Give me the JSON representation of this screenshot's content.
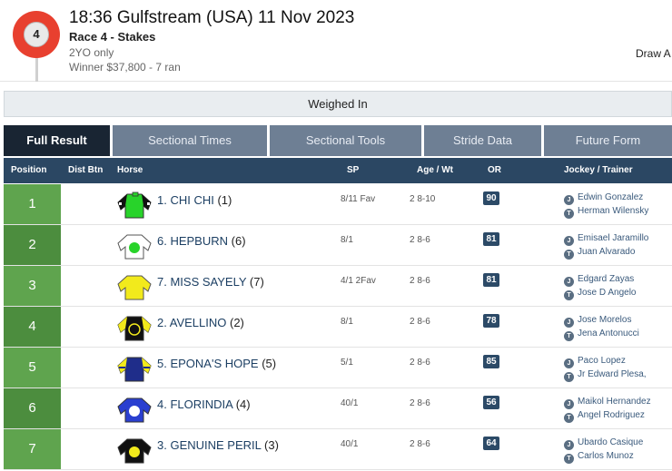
{
  "race": {
    "number": "4",
    "title": "18:36 Gulfstream (USA) 11 Nov 2023",
    "subtitle": "Race 4 - Stakes",
    "age_restriction": "2YO only",
    "winner_prize": "Winner $37,800 - 7 ran",
    "draw_label": "Draw A"
  },
  "status": {
    "weighed_in": "Weighed In"
  },
  "tabs": [
    {
      "label": "Full Result",
      "active": true
    },
    {
      "label": "Sectional Times",
      "active": false
    },
    {
      "label": "Sectional Tools",
      "active": false
    },
    {
      "label": "Stride Data",
      "active": false
    },
    {
      "label": "Future Form",
      "active": false
    }
  ],
  "columns": {
    "position": "Position",
    "dist_btn": "Dist Btn",
    "horse": "Horse",
    "sp": "SP",
    "age_wt": "Age / Wt",
    "or": "OR",
    "jockey_trainer": "Jockey / Trainer"
  },
  "icons": {
    "jockey": "J",
    "trainer": "T"
  },
  "colors": {
    "header_bar": "#2b4763",
    "tab_active": "#192533",
    "tab_inactive": "#6e7f94",
    "position_green": "#5fa44e",
    "badge_red": "#e8402f"
  },
  "results": [
    {
      "position": "1",
      "dist_btn": "",
      "name": "1. CHI CHI",
      "draw": "(1)",
      "sp": "8/11 Fav",
      "age_wt": "2 8-10",
      "or": "90",
      "jockey": "Edwin Gonzalez",
      "trainer": "Herman Wilensky",
      "silk": "green-black-sleeves-icon"
    },
    {
      "position": "2",
      "dist_btn": "",
      "name": "6. HEPBURN",
      "draw": "(6)",
      "sp": "8/1",
      "age_wt": "2 8-6",
      "or": "81",
      "jockey": "Emisael Jaramillo",
      "trainer": "Juan Alvarado",
      "silk": "white-green-disc-icon"
    },
    {
      "position": "3",
      "dist_btn": "",
      "name": "7. MISS SAYELY",
      "draw": "(7)",
      "sp": "4/1 2Fav",
      "age_wt": "2 8-6",
      "or": "81",
      "jockey": "Edgard Zayas",
      "trainer": "Jose D Angelo",
      "silk": "yellow-silk-icon"
    },
    {
      "position": "4",
      "dist_btn": "",
      "name": "2. AVELLINO",
      "draw": "(2)",
      "sp": "8/1",
      "age_wt": "2 8-6",
      "or": "78",
      "jockey": "Jose Morelos",
      "trainer": "Jena Antonucci",
      "silk": "black-yellow-sleeves-icon"
    },
    {
      "position": "5",
      "dist_btn": "",
      "name": "5. EPONA'S HOPE",
      "draw": "(5)",
      "sp": "5/1",
      "age_wt": "2 8-6",
      "or": "85",
      "jockey": "Paco Lopez",
      "trainer": "Jr Edward Plesa,",
      "silk": "navy-yellow-hoops-icon"
    },
    {
      "position": "6",
      "dist_btn": "",
      "name": "4. FLORINDIA",
      "draw": "(4)",
      "sp": "40/1",
      "age_wt": "2 8-6",
      "or": "56",
      "jockey": "Maikol Hernandez",
      "trainer": "Angel Rodriguez",
      "silk": "blue-white-disc-icon"
    },
    {
      "position": "7",
      "dist_btn": "",
      "name": "3. GENUINE PERIL",
      "draw": "(3)",
      "sp": "40/1",
      "age_wt": "2 8-6",
      "or": "64",
      "jockey": "Ubardo Casique",
      "trainer": "Carlos Munoz",
      "silk": "black-yellow-disc-icon"
    }
  ]
}
